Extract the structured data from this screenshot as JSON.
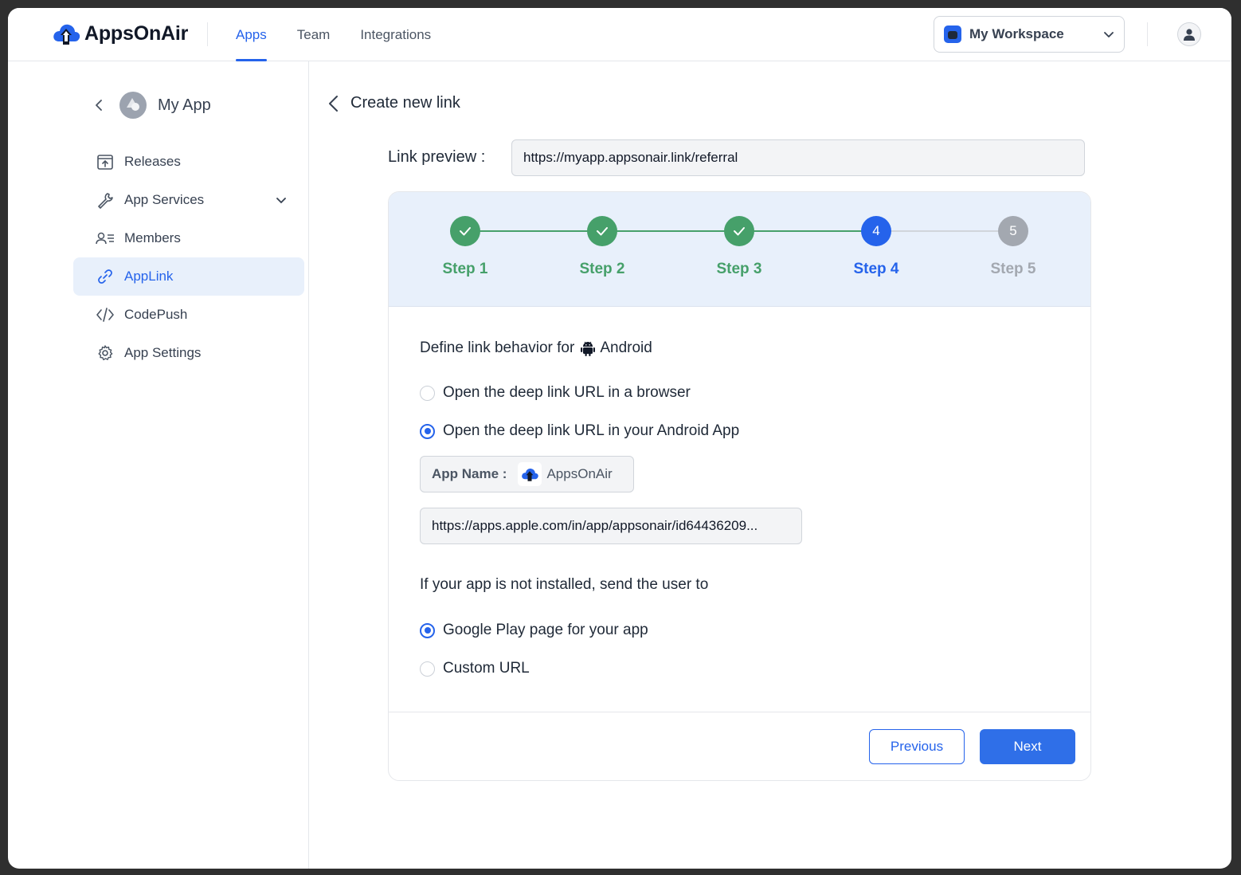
{
  "header": {
    "brand": "AppsOnAir",
    "nav": [
      {
        "label": "Apps",
        "active": true
      },
      {
        "label": "Team",
        "active": false
      },
      {
        "label": "Integrations",
        "active": false
      }
    ],
    "workspace": "My Workspace"
  },
  "sidebar": {
    "app_name": "My App",
    "items": [
      {
        "label": "Releases",
        "icon": "upload-box-icon",
        "active": false
      },
      {
        "label": "App Services",
        "icon": "wrench-icon",
        "active": false,
        "expandable": true
      },
      {
        "label": "Members",
        "icon": "members-icon",
        "active": false
      },
      {
        "label": "AppLink",
        "icon": "link-icon",
        "active": true
      },
      {
        "label": "CodePush",
        "icon": "code-icon",
        "active": false
      },
      {
        "label": "App Settings",
        "icon": "gear-icon",
        "active": false
      }
    ]
  },
  "main": {
    "title": "Create new link",
    "preview_label": "Link preview :",
    "preview_value": "https://myapp.appsonair.link/referral",
    "steps": [
      {
        "label": "Step 1",
        "number": "1",
        "state": "done"
      },
      {
        "label": "Step 2",
        "number": "2",
        "state": "done"
      },
      {
        "label": "Step 3",
        "number": "3",
        "state": "done"
      },
      {
        "label": "Step 4",
        "number": "4",
        "state": "current"
      },
      {
        "label": "Step 5",
        "number": "5",
        "state": "todo"
      }
    ],
    "behavior_title_prefix": "Define link behavior for",
    "behavior_platform": "Android",
    "behavior_options": [
      {
        "label": "Open the deep link URL in a browser",
        "selected": false
      },
      {
        "label": "Open the deep link URL in your Android App",
        "selected": true
      }
    ],
    "app_name_label": "App Name :",
    "app_name_value": "AppsOnAir",
    "store_url": "https://apps.apple.com/in/app/appsonair/id64436209...",
    "fallback_title": "If your app is not installed, send the user to",
    "fallback_options": [
      {
        "label": "Google Play page for your app",
        "selected": true
      },
      {
        "label": "Custom URL",
        "selected": false
      }
    ],
    "previous_label": "Previous",
    "next_label": "Next"
  },
  "colors": {
    "accent": "#2563eb",
    "done": "#46a06a",
    "todo": "#a3a8b0",
    "stepper_bg": "#e8f0fb"
  }
}
